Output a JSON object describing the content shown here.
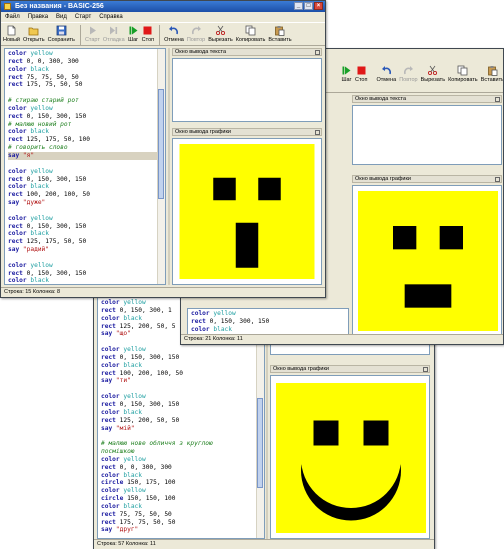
{
  "windows": {
    "w3": {
      "status": "Строка: 57 Колонка: 11",
      "code": [
        [
          [
            "kw",
            "color"
          ],
          [
            "cl",
            " yellow"
          ]
        ],
        [
          [
            "kw",
            "rect"
          ],
          [
            "",
            " 0, 150, 300, 1"
          ]
        ],
        [
          [
            "kw",
            "color"
          ],
          [
            "cl",
            " black"
          ]
        ],
        [
          [
            "kw",
            "rect"
          ],
          [
            "",
            " 125, 200, 50, 5"
          ]
        ],
        [
          [
            "kw",
            "say"
          ],
          [
            "st",
            " \"що\""
          ]
        ],
        [
          [
            "",
            ""
          ]
        ],
        [
          [
            "kw",
            "color"
          ],
          [
            "cl",
            " yellow"
          ]
        ],
        [
          [
            "kw",
            "rect"
          ],
          [
            "",
            " 0, 150, 300, 150"
          ]
        ],
        [
          [
            "kw",
            "color"
          ],
          [
            "cl",
            " black"
          ]
        ],
        [
          [
            "kw",
            "rect"
          ],
          [
            "",
            " 100, 200, 100, 50"
          ]
        ],
        [
          [
            "kw",
            "say"
          ],
          [
            "st",
            " \"ти\""
          ]
        ],
        [
          [
            "",
            ""
          ]
        ],
        [
          [
            "kw",
            "color"
          ],
          [
            "cl",
            " yellow"
          ]
        ],
        [
          [
            "kw",
            "rect"
          ],
          [
            "",
            " 0, 150, 300, 150"
          ]
        ],
        [
          [
            "kw",
            "color"
          ],
          [
            "cl",
            " black"
          ]
        ],
        [
          [
            "kw",
            "rect"
          ],
          [
            "",
            " 125, 200, 50, 50"
          ]
        ],
        [
          [
            "kw",
            "say"
          ],
          [
            "st",
            " \"мій\""
          ]
        ],
        [
          [
            "",
            ""
          ]
        ],
        [
          [
            "cm",
            "# малюю нове обличчя з круглою"
          ]
        ],
        [
          [
            "cm",
            "посмішкою"
          ]
        ],
        [
          [
            "kw",
            "color"
          ],
          [
            "cl",
            " yellow"
          ]
        ],
        [
          [
            "kw",
            "rect"
          ],
          [
            "",
            " 0, 0, 300, 300"
          ]
        ],
        [
          [
            "kw",
            "color"
          ],
          [
            "cl",
            " black"
          ]
        ],
        [
          [
            "kw",
            "circle"
          ],
          [
            "",
            " 150, 175, 100"
          ]
        ],
        [
          [
            "kw",
            "color"
          ],
          [
            "cl",
            " yellow"
          ]
        ],
        [
          [
            "kw",
            "circle"
          ],
          [
            "",
            " 150, 150, 100"
          ]
        ],
        [
          [
            "kw",
            "color"
          ],
          [
            "cl",
            " black"
          ]
        ],
        [
          [
            "kw",
            "rect"
          ],
          [
            "",
            " 75, 75, 50, 50"
          ]
        ],
        [
          [
            "kw",
            "rect"
          ],
          [
            "",
            " 175, 75, 50, 50"
          ]
        ],
        [
          [
            "kw",
            "say"
          ],
          [
            "st",
            " \"друг\""
          ]
        ]
      ],
      "gfx_header": "Окно вывода графики"
    },
    "w2": {
      "status": "Строка: 21 Колонка: 11",
      "code": [
        [
          [
            "kw",
            "color"
          ],
          [
            "cl",
            " yellow"
          ]
        ],
        [
          [
            "kw",
            "rect"
          ],
          [
            "",
            " 0, 150, 300, 150"
          ]
        ],
        [
          [
            "kw",
            "color"
          ],
          [
            "cl",
            " black"
          ]
        ]
      ],
      "toolbar": [
        {
          "label": "Шаг",
          "icon": "step-icon",
          "disabled": false
        },
        {
          "label": "Стоп",
          "icon": "stop-icon",
          "disabled": false
        },
        {
          "label": "Отмена",
          "icon": "undo-icon",
          "disabled": false
        },
        {
          "label": "Повтор",
          "icon": "redo-icon",
          "disabled": true
        },
        {
          "label": "Вырезать",
          "icon": "cut-icon",
          "disabled": false
        },
        {
          "label": "Копировать",
          "icon": "copy-icon",
          "disabled": false
        },
        {
          "label": "Вставить",
          "icon": "paste-icon",
          "disabled": false
        }
      ],
      "text_header": "Окно вывода текста",
      "gfx_header": "Окно вывода графики"
    },
    "w1": {
      "title": "Без названия - BASIC-256",
      "menu": [
        "Файл",
        "Правка",
        "Вид",
        "Старт",
        "Справка"
      ],
      "toolbar": [
        {
          "label": "Новый",
          "icon": "new-file-icon",
          "disabled": false
        },
        {
          "label": "Открыть",
          "icon": "open-folder-icon",
          "disabled": false
        },
        {
          "label": "Сохранить",
          "icon": "save-icon",
          "disabled": false
        },
        {
          "label": "Старт",
          "icon": "run-icon",
          "disabled": true
        },
        {
          "label": "Отладка",
          "icon": "debug-icon",
          "disabled": true
        },
        {
          "label": "Шаг",
          "icon": "step-icon",
          "disabled": false
        },
        {
          "label": "Стоп",
          "icon": "stop-icon",
          "disabled": false
        },
        {
          "label": "Отмена",
          "icon": "undo-icon",
          "disabled": false
        },
        {
          "label": "Повтор",
          "icon": "redo-icon",
          "disabled": true
        },
        {
          "label": "Вырезать",
          "icon": "cut-icon",
          "disabled": false
        },
        {
          "label": "Копировать",
          "icon": "copy-icon",
          "disabled": false
        },
        {
          "label": "Вставить",
          "icon": "paste-icon",
          "disabled": false
        }
      ],
      "text_header": "Окно вывода текста",
      "gfx_header": "Окно вывода графики",
      "status": "Строка: 15 Колонка: 8",
      "code": [
        [
          [
            "kw",
            "color"
          ],
          [
            "cl",
            " yellow"
          ]
        ],
        [
          [
            "kw",
            "rect"
          ],
          [
            "",
            " 0, 0, 300, 300"
          ]
        ],
        [
          [
            "kw",
            "color"
          ],
          [
            "cl",
            " black"
          ]
        ],
        [
          [
            "kw",
            "rect"
          ],
          [
            "",
            " 75, 75, 50, 50"
          ]
        ],
        [
          [
            "kw",
            "rect"
          ],
          [
            "",
            " 175, 75, 50, 50"
          ]
        ],
        [
          [
            "",
            ""
          ]
        ],
        [
          [
            "cm",
            "# стираю старий рот"
          ]
        ],
        [
          [
            "kw",
            "color"
          ],
          [
            "cl",
            " yellow"
          ]
        ],
        [
          [
            "kw",
            "rect"
          ],
          [
            "",
            " 0, 150, 300, 150"
          ]
        ],
        [
          [
            "cm",
            "# малюю новий рот"
          ]
        ],
        [
          [
            "kw",
            "color"
          ],
          [
            "cl",
            " black"
          ]
        ],
        [
          [
            "kw",
            "rect"
          ],
          [
            "",
            " 125, 175, 50, 100"
          ]
        ],
        [
          [
            "cm",
            "# говорить слово"
          ]
        ],
        [
          [
            "kw",
            "say"
          ],
          [
            "st",
            " \"я\""
          ],
          [
            "hl",
            ""
          ]
        ],
        [
          [
            "",
            ""
          ]
        ],
        [
          [
            "kw",
            "color"
          ],
          [
            "cl",
            " yellow"
          ]
        ],
        [
          [
            "kw",
            "rect"
          ],
          [
            "",
            " 0, 150, 300, 150"
          ]
        ],
        [
          [
            "kw",
            "color"
          ],
          [
            "cl",
            " black"
          ]
        ],
        [
          [
            "kw",
            "rect"
          ],
          [
            "",
            " 100, 200, 100, 50"
          ]
        ],
        [
          [
            "kw",
            "say"
          ],
          [
            "st",
            " \"дуже\""
          ]
        ],
        [
          [
            "",
            ""
          ]
        ],
        [
          [
            "kw",
            "color"
          ],
          [
            "cl",
            " yellow"
          ]
        ],
        [
          [
            "kw",
            "rect"
          ],
          [
            "",
            " 0, 150, 300, 150"
          ]
        ],
        [
          [
            "kw",
            "color"
          ],
          [
            "cl",
            " black"
          ]
        ],
        [
          [
            "kw",
            "rect"
          ],
          [
            "",
            " 125, 175, 50, 50"
          ]
        ],
        [
          [
            "kw",
            "say"
          ],
          [
            "st",
            " \"радий\""
          ]
        ],
        [
          [
            "",
            ""
          ]
        ],
        [
          [
            "kw",
            "color"
          ],
          [
            "cl",
            " yellow"
          ]
        ],
        [
          [
            "kw",
            "rect"
          ],
          [
            "",
            " 0, 150, 300, 150"
          ]
        ],
        [
          [
            "kw",
            "color"
          ],
          [
            "cl",
            " black"
          ]
        ]
      ]
    }
  },
  "faces": {
    "w1": {
      "bg": "#ffff00",
      "shapes": [
        [
          "rect",
          75,
          75,
          50,
          50
        ],
        [
          "rect",
          175,
          75,
          50,
          50
        ],
        [
          "rect",
          125,
          175,
          50,
          100
        ]
      ]
    },
    "w2": {
      "bg": "#ffff00",
      "shapes": [
        [
          "rect",
          75,
          75,
          50,
          50
        ],
        [
          "rect",
          175,
          75,
          50,
          50
        ],
        [
          "rect",
          100,
          200,
          100,
          50
        ]
      ]
    },
    "w3": {
      "bg": "#ffff00",
      "shapes": [
        [
          "smile",
          150,
          175,
          100,
          150,
          150,
          100
        ],
        [
          "rect",
          75,
          75,
          50,
          50
        ],
        [
          "rect",
          175,
          75,
          50,
          50
        ]
      ]
    }
  },
  "colors": {
    "accent": "#1c4fa8",
    "yellow": "#ffff00",
    "black": "#000000"
  }
}
